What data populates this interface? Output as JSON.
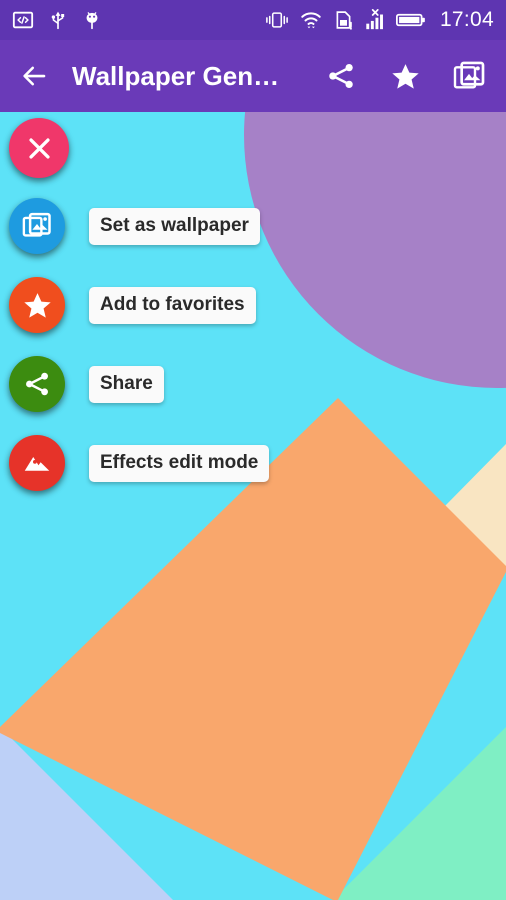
{
  "status_bar": {
    "icons": [
      "developer-code-icon",
      "usb-icon",
      "android-debug-icon"
    ],
    "right_icons": [
      "vibrate-icon",
      "wifi-icon",
      "sim-card-alert-icon",
      "signal-no-service-icon",
      "battery-icon"
    ],
    "time": "17:04"
  },
  "app_bar": {
    "back_label": "back-arrow",
    "title": "Wallpaper Gen…",
    "actions": [
      {
        "name": "share-button",
        "icon": "share-icon"
      },
      {
        "name": "favorite-button",
        "icon": "star-icon"
      },
      {
        "name": "collections-button",
        "icon": "collections-icon"
      }
    ]
  },
  "fab_menu": {
    "close": {
      "label": "",
      "icon": "close-icon",
      "color": "#F0376A"
    },
    "items": [
      {
        "label": "Set as wallpaper",
        "icon": "collections-icon",
        "color": "#1E9BE0",
        "name": "set-as-wallpaper"
      },
      {
        "label": "Add to favorites",
        "icon": "star-icon",
        "color": "#F04E1E",
        "name": "add-to-favorites"
      },
      {
        "label": "Share",
        "icon": "share-icon",
        "color": "#3C8C10",
        "name": "share"
      },
      {
        "label": "Effects edit mode",
        "icon": "landscape-icon",
        "color": "#E63329",
        "name": "effects-edit-mode"
      }
    ]
  },
  "wallpaper": {
    "background_color": "#5DE2F7",
    "shapes": [
      {
        "name": "purple-circle",
        "color": "#A681C7"
      },
      {
        "name": "orange-diamond",
        "color": "#F9A76C"
      },
      {
        "name": "cream-triangle",
        "color": "#F9E5C2"
      },
      {
        "name": "periwinkle-corner",
        "color": "#BDD0F7"
      },
      {
        "name": "mint-corner",
        "color": "#7FEFC4"
      }
    ]
  },
  "theme": {
    "status_bar_color": "#5E35B1",
    "app_bar_color": "#6A3AB8",
    "label_bg": "#FAFAFA",
    "label_text": "#2A2A2A"
  }
}
